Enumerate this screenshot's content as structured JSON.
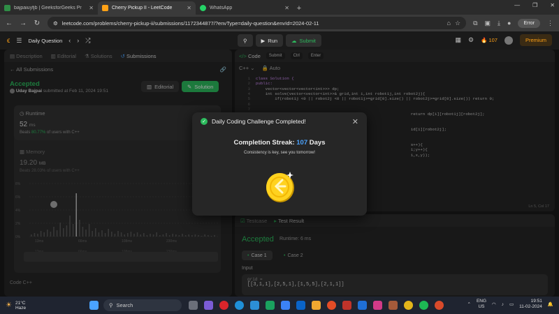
{
  "browser": {
    "tabs": [
      {
        "title": "bajpaiuyfjb | GeeksforGeeks Pr",
        "color": "#2f8d46"
      },
      {
        "title": "Cherry Pickup II - LeetCode",
        "color": "#ffa116"
      },
      {
        "title": "WhatsApp",
        "color": "#25d366"
      }
    ],
    "url": "leetcode.com/problems/cherry-pickup-ii/submissions/1172344877/?envType=daily-question&envId=2024-02-11",
    "error_label": "Error"
  },
  "lc_header": {
    "daily_label": "Daily Question",
    "run_label": "Run",
    "submit_label": "Submit",
    "streak_count": "107",
    "premium_label": "Premium"
  },
  "left": {
    "tabs": [
      "Description",
      "Editorial",
      "Solutions",
      "Submissions"
    ],
    "all_submissions": "All Submissions",
    "status": "Accepted",
    "user": "Uday Bajpai",
    "submitted_at": "submitted at Feb 11, 2024 19:51",
    "editorial_btn": "Editorial",
    "solution_btn": "Solution",
    "runtime_label": "Runtime",
    "runtime_value": "52",
    "runtime_unit": "ms",
    "runtime_beats_prefix": "Beats",
    "runtime_beats_pct": "80.77%",
    "runtime_beats_suffix": "of users with C++",
    "memory_label": "Memory",
    "memory_value": "19.20",
    "memory_unit": "MB",
    "memory_beats": "Beats 28.03% of users with C++",
    "y_ticks": [
      "8%",
      "6%",
      "4%",
      "2%",
      "0%"
    ],
    "x_ticks": [
      "13ms",
      "66ms",
      "108ms",
      "230ms"
    ],
    "footer": "Code   C++"
  },
  "code": {
    "tab_label": "Code",
    "kbd": [
      "Submit",
      "Ctrl",
      "Enter"
    ],
    "lang": "C++",
    "auto": "Auto",
    "lines": [
      "class Solution {",
      "public:",
      "    vector<vector<vector<int>>> dp;",
      "    int solve(vector<vector<int>>& grid,int i,int robot1j,int robot2j){",
      "        if(robot1j <0 || robot2j <0 || robot1j>=grid[0].size() || robot2j>=grid[0].size()) return 0;",
      "",
      "",
      "                                                                 return dp[i][robot1j][robot2j];",
      "",
      "",
      "                                                                 id[i][robot2j];",
      "",
      "",
      "                                                                 s++){",
      "                                                                 1;y++){",
      "                                                                 1,x,y));",
      ""
    ],
    "cursor": "Ln 5, Col 17"
  },
  "result": {
    "tabs": [
      "Testcase",
      "Test Result"
    ],
    "status": "Accepted",
    "runtime": "Runtime: 6 ms",
    "cases": [
      "Case 1",
      "Case 2"
    ],
    "input_label": "Input",
    "grid_label": "grid =",
    "grid_value": "[[3,1,1],[2,5,1],[1,5,5],[2,1,1]]"
  },
  "modal": {
    "title": "Daily Coding Challenge Completed!",
    "streak_label": "Completion Streak:",
    "streak_value": "107",
    "streak_unit": "Days",
    "message": "Consistency is key, see you tomorrow!"
  },
  "taskbar": {
    "temp": "21°C",
    "weather": "Haze",
    "search": "Search",
    "lang1": "ENG",
    "lang2": "US",
    "time": "19:51",
    "date": "11-02-2024"
  },
  "colors": {
    "accent_green": "#2cbb5d",
    "leetcode_orange": "#ffa116",
    "streak_blue": "#4ba3ff"
  }
}
